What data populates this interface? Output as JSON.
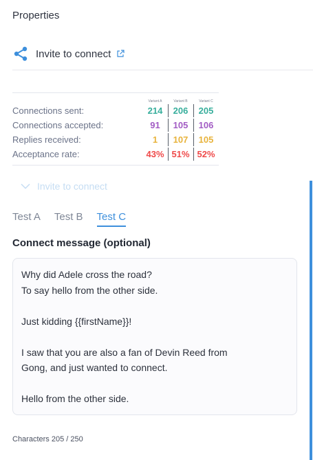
{
  "header": {
    "title": "Properties"
  },
  "invite": {
    "label": "Invite to connect",
    "icon": "share-icon",
    "link_icon": "external-link-icon",
    "accent": "#3d8fdc"
  },
  "stats": {
    "variants": [
      "Variant A",
      "Variant B",
      "Variant C"
    ],
    "rows": [
      {
        "label": "Connections sent:",
        "values": [
          "214",
          "206",
          "205"
        ],
        "color": "#37ae9c"
      },
      {
        "label": "Connections accepted:",
        "values": [
          "91",
          "105",
          "106"
        ],
        "color": "#a25cc4"
      },
      {
        "label": "Replies received:",
        "values": [
          "1",
          "107",
          "105"
        ],
        "color": "#e8b33c"
      },
      {
        "label": "Acceptance rate:",
        "values": [
          "43%",
          "51%",
          "52%"
        ],
        "color": "#ef4a4a"
      }
    ]
  },
  "collapsed_section": {
    "label": "Invite to connect",
    "icon": "chevron-down-icon"
  },
  "tabs": [
    {
      "label": "Test A",
      "active": false
    },
    {
      "label": "Test B",
      "active": false
    },
    {
      "label": "Test C",
      "active": true
    }
  ],
  "message": {
    "label": "Connect message (optional)",
    "lines": [
      "Why did Adele cross the road?",
      "To say hello from the other side.",
      "",
      "Just kidding {{firstName}}!",
      "",
      "I saw that you are also a fan of Devin Reed from",
      "Gong, and just wanted to connect.",
      "",
      "Hello from the other side."
    ]
  },
  "characters": {
    "text": "Characters 205 / 250"
  }
}
